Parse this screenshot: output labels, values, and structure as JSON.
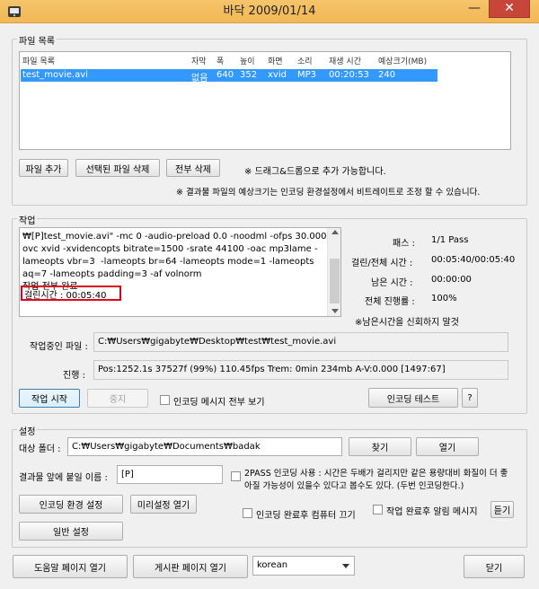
{
  "window": {
    "title": "바닥 2009/01/14",
    "minimize_glyph": "—",
    "close_glyph": "✕"
  },
  "file_list": {
    "group_label": "파일 목록",
    "columns": [
      "파일 목록",
      "자막",
      "폭",
      "높이",
      "화면",
      "소리",
      "재생 시간",
      "예상크기(MB)"
    ],
    "rows": [
      [
        "test_movie.avi",
        "없음",
        "640",
        "352",
        "xvid",
        "MP3",
        "00:20:53",
        "240"
      ]
    ],
    "add_button": "파일 추가",
    "delete_selected_button": "선택된 파일 삭제",
    "delete_all_button": "전부 삭제",
    "drag_hint": "※ 드래그&드롭으로 추가 가능합니다.",
    "size_hint": "※ 결과물 파일의 예상크기는 인코딩 환경설정에서 비트레이트로 조정 할 수 있습니다."
  },
  "job": {
    "group_label": "작업",
    "log_text": "₩[P]test_movie.avi\" -mc 0 -audio-preload 0.0 -noodml -ofps 30.000 -ovc xvid -xvidencopts bitrate=1500 -srate 44100 -oac mp3lame -lameopts vbr=3  -lameopts br=64 -lameopts mode=1 -lameopts aq=7 -lameopts padding=3 -af volnorm\n작업 전부 완료",
    "elapsed_line": "걸린시간 : 00:05:40",
    "stats": {
      "pass_label": "패스 :",
      "pass_value": "1/1 Pass",
      "elapsed_total_label": "걸린/전체 시간 :",
      "elapsed_total_value": "00:05:40/00:05:40",
      "remaining_label": "남은 시간 :",
      "remaining_value": "00:00:00",
      "progress_label": "전체 진행률 :",
      "progress_value": "100%"
    },
    "remaining_note": "※남은시간을 신회하지 말것",
    "current_file_label": "작업중인 파일 :",
    "current_file_value": "C:₩Users₩gigabyte₩Desktop₩test₩test_movie.avi",
    "progress_line_label": "진행 :",
    "progress_line_value": "Pos:1252.1s  37527f (99%) 110.45fps Trem:   0min 234mb  A-V:0.000 [1497:67]",
    "start_button": "작업 시작",
    "stop_button": "중지",
    "show_all_messages_label": "인코딩 메시지 전부 보기",
    "encoding_test_button": "인코딩 테스트",
    "help_button": "?"
  },
  "settings": {
    "group_label": "설정",
    "target_folder_label": "대상 폴더 :",
    "target_folder_value": "C:₩Users₩gigabyte₩Documents₩badak",
    "find_button": "찾기",
    "open_button": "열기",
    "prefix_label": "결과물 앞에 붙일 이름 :",
    "prefix_value": "[P]",
    "two_pass_text": "2PASS 인코딩 사용 : 시간은 두배가 걸리지만 같은 용량대비 화질이 더 좋아질 가능성이 있을수 있다고 봅수도 있다. (두번 인코딩한다.)",
    "encoding_env_button": "인코딩 환경 설정",
    "preset_button": "미리설정 열기",
    "shutdown_label": "인코딩 완료후 컴퓨터 끄기",
    "alert_label": "작업 완료후 알림 메시지",
    "listen_button": "듣기",
    "general_button": "일반 설정"
  },
  "footer": {
    "help_page_button": "도움말 페이지 열기",
    "board_page_button": "게시판 페이지 열기",
    "language_value": "korean",
    "close_button": "닫기"
  },
  "colors": {
    "titlebar": "#f1b855",
    "selection": "#3399ff",
    "highlight_box": "#e0001b",
    "close_button": "#c7463a"
  }
}
